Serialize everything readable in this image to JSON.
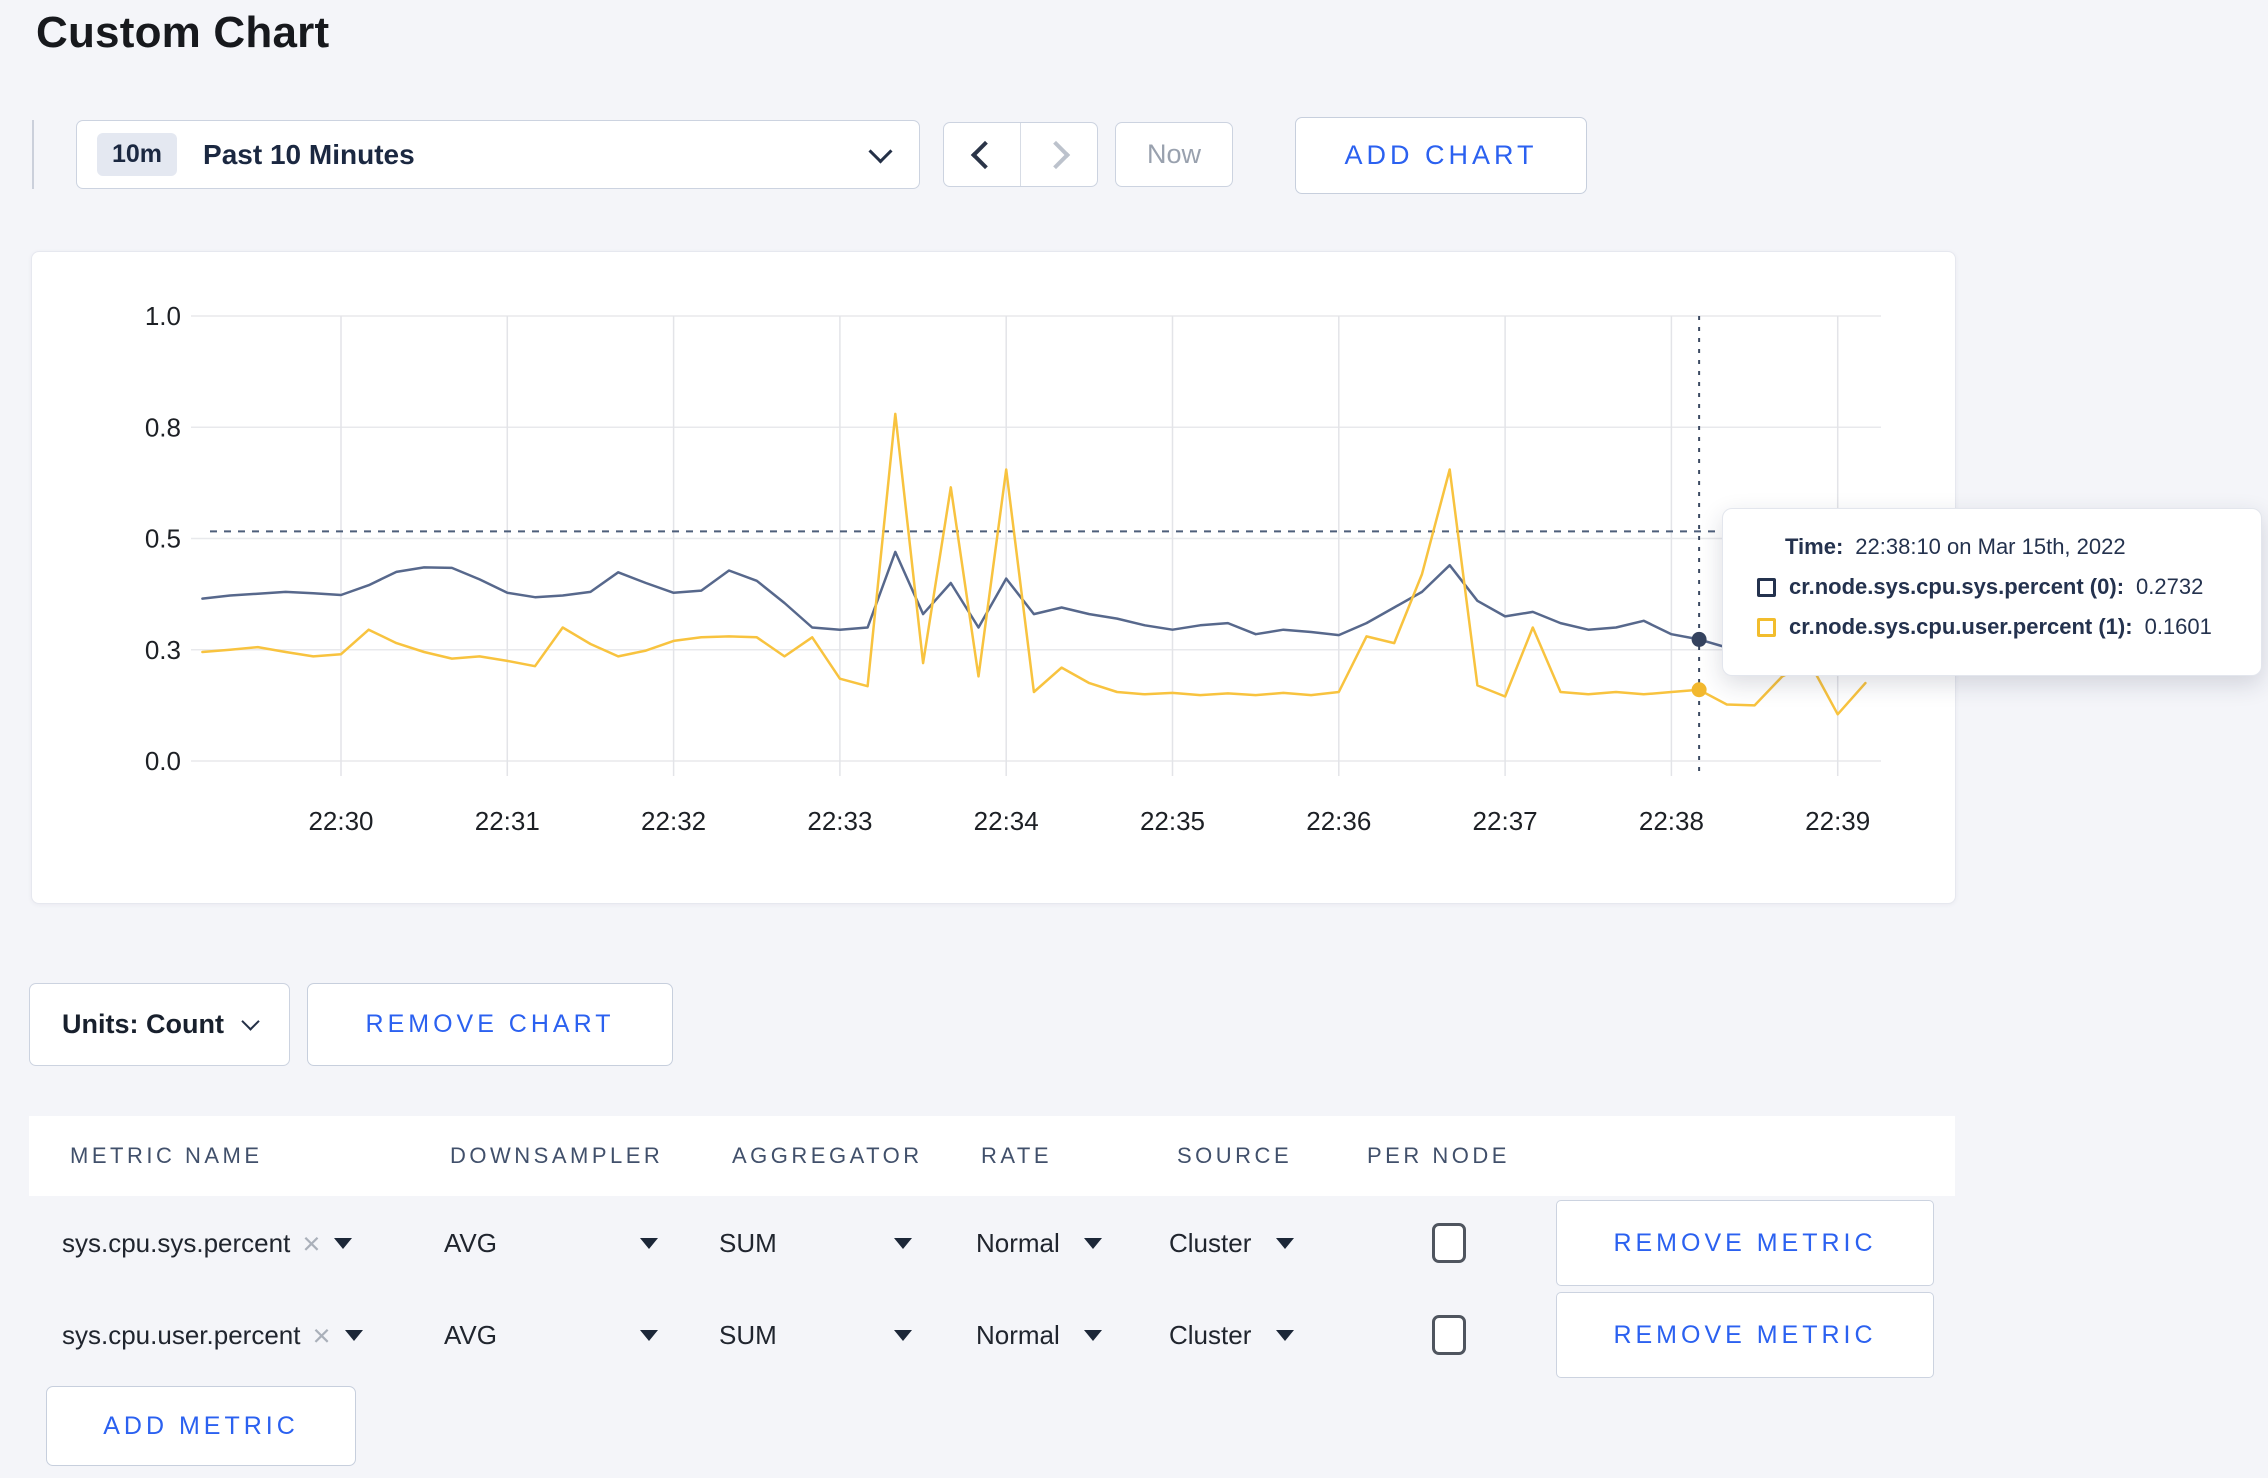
{
  "page_title": "Custom Chart",
  "accent_blue": "#2b61f0",
  "toolbar": {
    "time_range": {
      "badge": "10m",
      "label": "Past 10 Minutes"
    },
    "now_label": "Now",
    "add_chart_label": "ADD CHART"
  },
  "tooltip": {
    "time_label": "Time:",
    "time_value": "22:38:10 on Mar 15th, 2022",
    "series": [
      {
        "label": "cr.node.sys.cpu.sys.percent (0):",
        "value": "0.2732",
        "swatch_color": "#24324e"
      },
      {
        "label": "cr.node.sys.cpu.user.percent (1):",
        "value": "0.1601",
        "swatch_color": "#f2bd2d"
      }
    ]
  },
  "units_label": "Units: Count",
  "remove_chart_label": "REMOVE CHART",
  "metrics_table": {
    "columns": [
      "METRIC NAME",
      "DOWNSAMPLER",
      "AGGREGATOR",
      "RATE",
      "SOURCE",
      "PER NODE"
    ],
    "rows": [
      {
        "metric_name": "sys.cpu.sys.percent",
        "downsampler": "AVG",
        "aggregator": "SUM",
        "rate": "Normal",
        "source": "Cluster",
        "per_node_checked": false,
        "remove_label": "REMOVE METRIC"
      },
      {
        "metric_name": "sys.cpu.user.percent",
        "downsampler": "AVG",
        "aggregator": "SUM",
        "rate": "Normal",
        "source": "Cluster",
        "per_node_checked": false,
        "remove_label": "REMOVE METRIC"
      }
    ],
    "add_metric_label": "ADD METRIC"
  },
  "chart_data": {
    "type": "line",
    "title": "",
    "xlabel": "",
    "ylabel": "",
    "ylim": [
      0,
      1
    ],
    "grid": true,
    "x_start": "22:29:10",
    "x_interval_seconds": 10,
    "x_tick_labels": [
      "22:30",
      "22:31",
      "22:32",
      "22:33",
      "22:34",
      "22:35",
      "22:36",
      "22:37",
      "22:38",
      "22:39"
    ],
    "y_ticks": [
      {
        "value": 0,
        "label": "0.0"
      },
      {
        "value": 0.25,
        "label": "0.3"
      },
      {
        "value": 0.5,
        "label": "0.5"
      },
      {
        "value": 0.75,
        "label": "0.8"
      },
      {
        "value": 1,
        "label": "1.0"
      }
    ],
    "crosshair_index": 54,
    "crosshair_time": "22:38:10",
    "crosshair_value_y": 0.516,
    "series": [
      {
        "name": "cr.node.sys.cpu.sys.percent",
        "color": "#57688c",
        "dot_color": "#35435f",
        "values": [
          0.365,
          0.372,
          0.376,
          0.38,
          0.377,
          0.373,
          0.395,
          0.425,
          0.435,
          0.434,
          0.408,
          0.378,
          0.368,
          0.372,
          0.38,
          0.424,
          0.4,
          0.378,
          0.383,
          0.428,
          0.405,
          0.355,
          0.3,
          0.295,
          0.3,
          0.47,
          0.33,
          0.4,
          0.3,
          0.41,
          0.33,
          0.345,
          0.33,
          0.32,
          0.305,
          0.295,
          0.305,
          0.31,
          0.285,
          0.295,
          0.29,
          0.283,
          0.31,
          0.345,
          0.38,
          0.44,
          0.36,
          0.325,
          0.335,
          0.31,
          0.295,
          0.3,
          0.315,
          0.285,
          0.2732,
          0.255,
          0.265,
          0.275,
          0.285,
          0.29,
          0.29
        ]
      },
      {
        "name": "cr.node.sys.cpu.user.percent",
        "color": "#f8c33f",
        "dot_color": "#f2b82e",
        "values": [
          0.245,
          0.25,
          0.256,
          0.245,
          0.235,
          0.24,
          0.295,
          0.265,
          0.245,
          0.23,
          0.235,
          0.225,
          0.213,
          0.3,
          0.263,
          0.235,
          0.248,
          0.27,
          0.278,
          0.28,
          0.278,
          0.235,
          0.278,
          0.185,
          0.168,
          0.78,
          0.22,
          0.615,
          0.19,
          0.655,
          0.155,
          0.21,
          0.175,
          0.155,
          0.15,
          0.153,
          0.148,
          0.152,
          0.148,
          0.153,
          0.148,
          0.155,
          0.28,
          0.265,
          0.42,
          0.655,
          0.17,
          0.145,
          0.3,
          0.155,
          0.15,
          0.155,
          0.15,
          0.155,
          0.1601,
          0.127,
          0.125,
          0.19,
          0.22,
          0.105,
          0.175
        ]
      }
    ]
  }
}
